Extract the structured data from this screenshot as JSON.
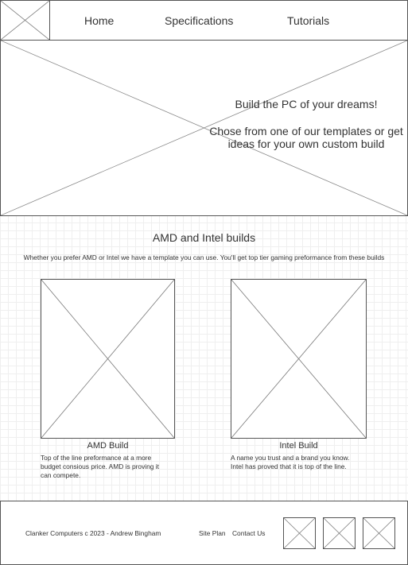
{
  "nav": {
    "logo_icon": "image-placeholder-icon",
    "items": [
      {
        "label": "Home"
      },
      {
        "label": "Specifications"
      },
      {
        "label": "Tutorials"
      }
    ]
  },
  "hero": {
    "image_icon": "image-placeholder-icon",
    "headline": "Build the PC of your dreams!",
    "subline_1": "Chose from one of our templates or get",
    "subline_2": "ideas for your own custom build"
  },
  "builds": {
    "title": "AMD and Intel builds",
    "intro": "Whether you prefer AMD or Intel we have a template you can use. You'll get top tier gaming preformance from these builds",
    "cards": [
      {
        "title": "AMD Build",
        "desc_lines": [
          "Top of the line preformance at a more",
          "budget consious price. AMD is proving it",
          "can compete."
        ]
      },
      {
        "title": "Intel Build",
        "desc_lines": [
          "A name you trust and a brand you know.",
          "Intel has proved that it is top of the line."
        ]
      }
    ]
  },
  "footer": {
    "copyright": "Clanker Computers c 2023 - Andrew Bingham",
    "site_plan": "Site Plan",
    "contact": "Contact Us",
    "social_icons": [
      "image-placeholder-icon",
      "image-placeholder-icon",
      "image-placeholder-icon"
    ]
  },
  "colors": {
    "line": "#555555",
    "grid": "#efefef",
    "text": "#333333"
  }
}
